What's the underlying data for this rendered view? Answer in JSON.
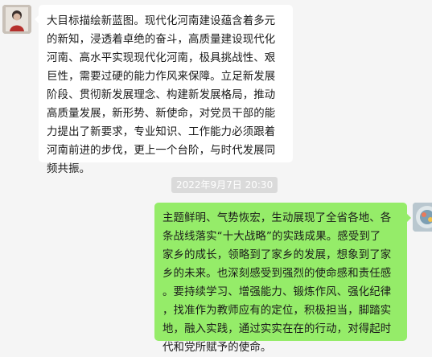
{
  "messages": [
    {
      "side": "left",
      "avatar_icon": "user-avatar-icon",
      "lines": [
        "大目标描绘新蓝图。现代化河南建设蕴含着多元",
        "的新知，浸透着卓绝的奋斗，高质量建设现代化",
        "河南、高水平实现现代化河南，极具挑战性、艰",
        "巨性，需要过硬的能力作风来保障。立足新发展",
        "阶段、贯彻新发展理念、构建新发展格局，推动",
        "高质量发展，新形势、新使命，对党员干部的能",
        "力提出了新要求，专业知识、工作能力必须跟着",
        "河南前进的步伐，更上一个台阶，与时代发展同",
        "频共振。"
      ]
    },
    {
      "side": "right",
      "avatar_icon": "self-avatar-icon",
      "lines": [
        "主题鲜明、气势恢宏，生动展现了全省各地、各",
        "条战线落实“十大战略”的实践成果。感受到了",
        "家乡的成长，领略到了家乡的发展，想象到了家",
        "乡的未来。也深刻感受到强烈的使命感和责任感",
        "。要持续学习、增强能力、锻炼作风、强化纪律",
        "，找准作为教师应有的定位，积极担当，脚踏实",
        "地，融入实践，通过实实在在的行动，对得起时",
        "代和党所赋予的使命。"
      ]
    }
  ],
  "timestamp": "2022年9月7日 20:30",
  "colors": {
    "background": "#f5f5f5",
    "incoming_bubble": "#ffffff",
    "outgoing_bubble": "#95ec69",
    "timestamp_bg": "#dadada"
  }
}
